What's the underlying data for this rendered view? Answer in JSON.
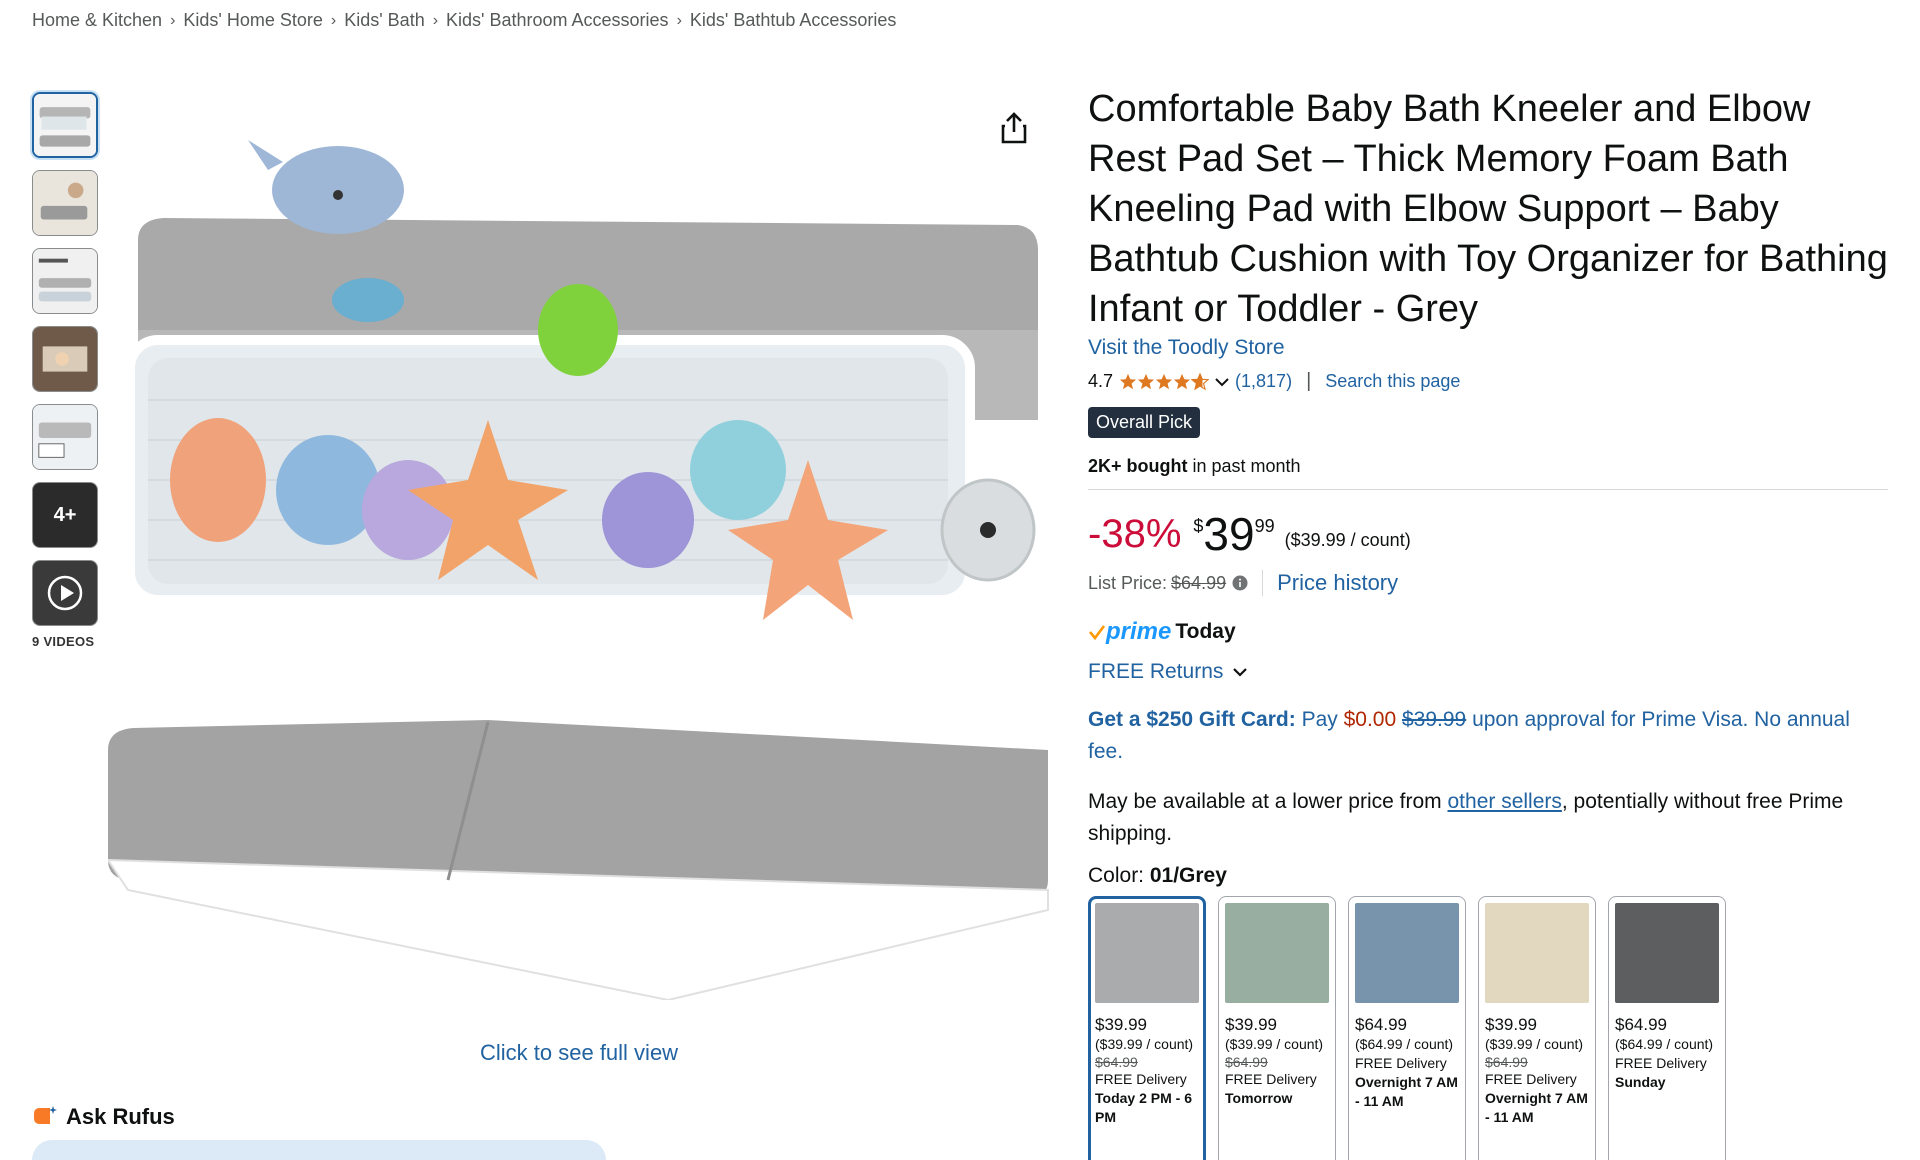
{
  "breadcrumb": [
    "Home & Kitchen",
    "Kids' Home Store",
    "Kids' Bath",
    "Kids' Bathroom Accessories",
    "Kids' Bathtub Accessories"
  ],
  "gallery": {
    "more_label": "4+",
    "videos_label": "9 VIDEOS",
    "full_view": "Click to see full view"
  },
  "rufus": {
    "label": "Ask Rufus"
  },
  "product": {
    "title": "Comfortable Baby Bath Kneeler and Elbow Rest Pad Set – Thick Memory Foam Bath Kneeling Pad with Elbow Support – Baby Bathtub Cushion with Toy Organizer for Bathing Infant or Toddler - Grey",
    "store": "Visit the Toodly Store",
    "rating": "4.7",
    "rating_count": "(1,817)",
    "search_page": "Search this page",
    "badge": "Overall Pick",
    "bought_bold": "2K+ bought",
    "bought_rest": " in past month"
  },
  "price": {
    "discount": "-38%",
    "currency": "$",
    "whole": "39",
    "fraction": "99",
    "unit": "($39.99 / count)",
    "list_label": "List Price:",
    "list_value": "$64.99",
    "history": "Price history"
  },
  "prime": {
    "logo": "prime",
    "today": "Today",
    "returns": "FREE Returns"
  },
  "gift": {
    "bold": "Get a $250 Gift Card:",
    "pay": " Pay ",
    "zero": "$0.00",
    "strike": "$39.99",
    "rest": " upon approval for Prime Visa. No annual fee."
  },
  "lower": {
    "pre": "May be available at a lower price from ",
    "link": "other sellers",
    "post": ", potentially without free Prime shipping."
  },
  "color": {
    "label": "Color: ",
    "value": "01/Grey",
    "options": [
      {
        "color": "#a9abad",
        "price": "$39.99",
        "unit": "($39.99 / count)",
        "list": "$64.99",
        "delivery": "FREE Delivery",
        "date": "Today 2 PM - 6 PM"
      },
      {
        "color": "#97aea0",
        "price": "$39.99",
        "unit": "($39.99 / count)",
        "list": "$64.99",
        "delivery": "FREE Delivery",
        "date": "Tomorrow"
      },
      {
        "color": "#7894ad",
        "price": "$64.99",
        "unit": "($64.99 / count)",
        "list": "",
        "delivery": "FREE Delivery",
        "date": "Overnight 7 AM - 11 AM"
      },
      {
        "color": "#e2d8c0",
        "price": "$39.99",
        "unit": "($39.99 / count)",
        "list": "$64.99",
        "delivery": "FREE Delivery",
        "date": "Overnight 7 AM - 11 AM"
      },
      {
        "color": "#5d5e60",
        "price": "$64.99",
        "unit": "($64.99 / count)",
        "list": "",
        "delivery": "FREE Delivery",
        "date": "Sunday"
      }
    ]
  }
}
